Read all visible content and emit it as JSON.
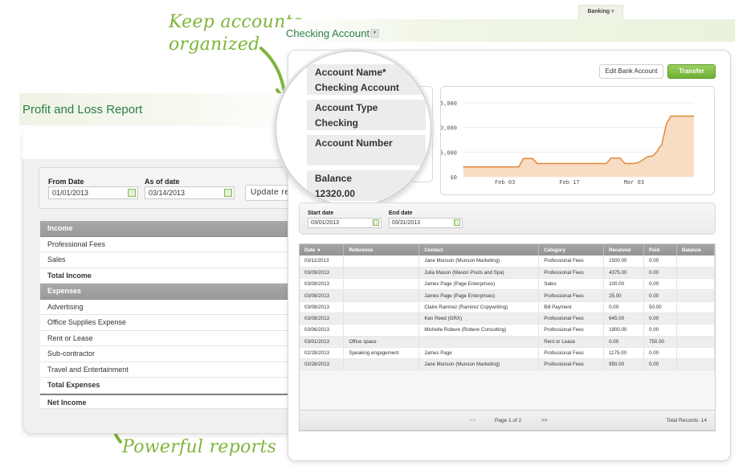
{
  "annotations": {
    "top": "Keep accounts organized",
    "top_line1": "Keep accounts",
    "top_line2": "organized",
    "bottom": "Powerful reports"
  },
  "profit_loss": {
    "title": "Profit and Loss Report",
    "from_date_label": "From Date",
    "from_date": "01/01/2013",
    "as_of_label": "As of date",
    "as_of_date": "03/14/2013",
    "update_button": "Update re",
    "rows": [
      {
        "label": "Income",
        "type": "cat"
      },
      {
        "label": "Professional Fees",
        "type": "item"
      },
      {
        "label": "Sales",
        "type": "item"
      },
      {
        "label": "Total Income",
        "type": "total"
      },
      {
        "label": "Expenses",
        "type": "cat"
      },
      {
        "label": "Advertising",
        "type": "item"
      },
      {
        "label": "Office Supplies Expense",
        "type": "item"
      },
      {
        "label": "Rent or Lease",
        "type": "item"
      },
      {
        "label": "Sub-contractor",
        "type": "item"
      },
      {
        "label": "Travel and Entertainment",
        "type": "item"
      },
      {
        "label": "Total Expenses",
        "type": "total"
      },
      {
        "label": "Net Income",
        "type": "net"
      }
    ]
  },
  "banking": {
    "tab": "Banking",
    "title": "Checking Account",
    "edit_button": "Edit Bank Account",
    "transfer_button": "Transfer",
    "account": {
      "name_label": "Account Name*",
      "name": "Checking Account",
      "type_label": "Account Type",
      "type": "Checking",
      "number_label": "Account Number",
      "number": "",
      "balance_label": "Balance",
      "balance": "12320.00"
    },
    "start_date_label": "Start date",
    "start_date": "03/01/2013",
    "end_date_label": "End date",
    "end_date": "03/31/2013",
    "columns": [
      "Date",
      "Reference",
      "Contact",
      "Category",
      "Received",
      "Paid",
      "Balance"
    ],
    "sort_indicator": "▾",
    "transactions": [
      [
        "03/11/2013",
        "",
        "Jane Munson (Munson Marketing)",
        "Professional Fees",
        "1500.00",
        "0.00",
        ""
      ],
      [
        "03/09/2013",
        "",
        "Julia Mason (Mason Pools and Spa)",
        "Professional Fees",
        "4375.00",
        "0.00",
        ""
      ],
      [
        "03/08/2013",
        "",
        "James Page (Page Enterprises)",
        "Sales",
        "100.00",
        "0.00",
        ""
      ],
      [
        "03/08/2013",
        "",
        "James Page (Page Enterprises)",
        "Professional Fees",
        "25.00",
        "0.00",
        ""
      ],
      [
        "03/08/2013",
        "",
        "Claire Ramirez (Ramirez Copywriting)",
        "Bill Payment",
        "0.00",
        "50.00",
        ""
      ],
      [
        "03/08/2013",
        "",
        "Ken Reed (GRX)",
        "Professional Fees",
        "645.00",
        "0.00",
        ""
      ],
      [
        "03/06/2013",
        "",
        "Michelle Robere (Robere Consulting)",
        "Professional Fees",
        "1900.00",
        "0.00",
        ""
      ],
      [
        "03/01/2013",
        "Office space",
        "",
        "Rent or Lease",
        "0.00",
        "750.00",
        ""
      ],
      [
        "02/28/2013",
        "Speaking engagement",
        "James Page",
        "Professional Fees",
        "1175.00",
        "0.00",
        ""
      ],
      [
        "02/28/2013",
        "",
        "Jane Munson (Munson Marketing)",
        "Professional Fees",
        "950.00",
        "0.00",
        ""
      ]
    ],
    "pager": {
      "prev": "<<",
      "page_text": "Page 1 of 2",
      "next": ">>",
      "total_text": "Total Records: 14"
    }
  },
  "chart_data": {
    "type": "area",
    "title": "",
    "xlabel": "",
    "ylabel": "",
    "ylim": [
      0,
      15000
    ],
    "yticks": [
      "$15,000",
      "$10,000",
      "$5,000",
      "$0"
    ],
    "ytick_values": [
      15000,
      10000,
      5000,
      0
    ],
    "xticks": [
      "Feb 03",
      "Feb 17",
      "Mar 03"
    ],
    "xtick_days": [
      3,
      17,
      31
    ],
    "xlim_days": [
      -6,
      44
    ],
    "series": [
      {
        "x_days": [
          -6,
          4,
          6,
          7,
          9,
          10,
          20,
          25,
          26,
          28,
          29,
          30,
          31,
          32,
          34,
          35,
          36,
          36.5,
          37,
          38,
          39,
          42,
          43,
          44
        ],
        "values": [
          2000,
          2000,
          2000,
          3700,
          3700,
          2700,
          2700,
          2700,
          3800,
          3800,
          2700,
          2700,
          2700,
          2900,
          4100,
          4200,
          5100,
          6000,
          6400,
          10700,
          12300,
          12300,
          12300,
          12300
        ]
      }
    ],
    "line_color": "#e08a3c",
    "fill_color": "#f8dcc4",
    "grid": "horizontal"
  }
}
